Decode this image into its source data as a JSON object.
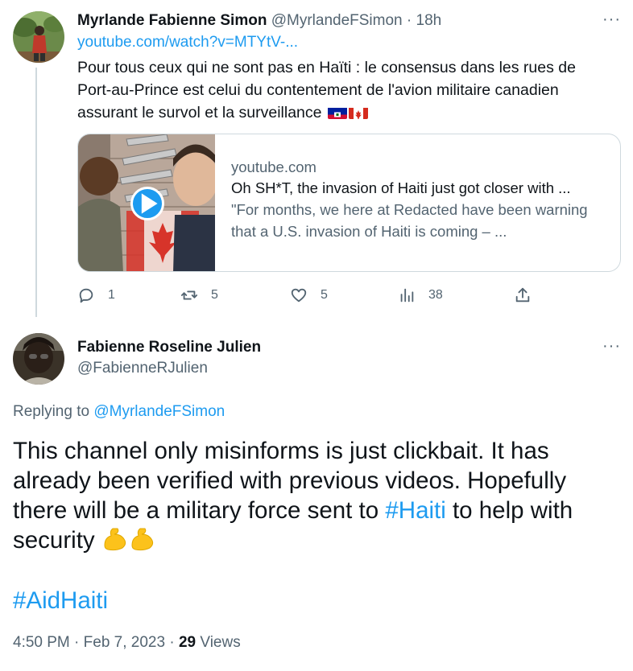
{
  "tweet1": {
    "author_name": "Myrlande Fabienne Simon",
    "author_handle": "@MyrlandeFSimon",
    "separator": "·",
    "time": "18h",
    "link": "youtube.com/watch?v=MTYtV-...",
    "text": "Pour tous ceux qui ne sont pas en Haïti : le consensus dans les rues de Port-au-Prince est celui du contentement de l'avion militaire canadien assurant le survol et la surveillance",
    "flags": [
      "haiti-flag",
      "canada-flag"
    ],
    "card": {
      "domain": "youtube.com",
      "title": "Oh SH*T, the invasion of Haiti just got closer with ...",
      "description": "\"For months, we here at Redacted have been warning that a U.S. invasion of Haiti is coming – ..."
    },
    "actions": {
      "replies": "1",
      "retweets": "5",
      "likes": "5",
      "views": "38"
    }
  },
  "tweet2": {
    "author_name": "Fabienne Roseline Julien",
    "author_handle": "@FabienneRJulien",
    "replying_prefix": "Replying to",
    "replying_to": "@MyrlandeFSimon",
    "text_part1": "This channel only misinforms is just clickbait. It has already been verified with previous videos. Hopefully there will be a military force sent to ",
    "text_hashtag": "#Haiti",
    "text_part2": " to help with security",
    "emojis": [
      "flexed-biceps-icon",
      "flexed-biceps-icon"
    ],
    "hashtag_line": "#AidHaiti",
    "timestamp": "4:50 PM · Feb 7, 2023 · ",
    "views_count": "29",
    "views_label": "Views"
  },
  "more_label": "···",
  "colors": {
    "accent": "#1d9bf0",
    "text_primary": "#0f1419",
    "text_secondary": "#536471",
    "border": "#cfd9de"
  }
}
